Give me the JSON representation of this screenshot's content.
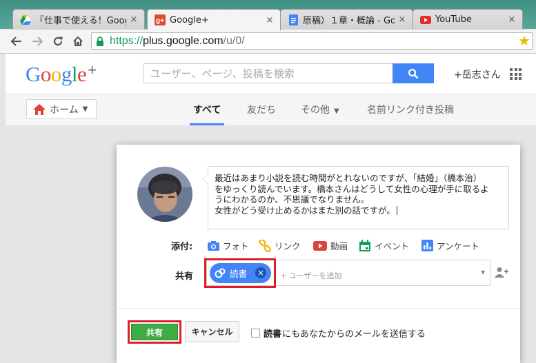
{
  "browser": {
    "tabs": [
      {
        "title": "『仕事で使える！Goog",
        "icon": "google-drive-icon",
        "active": false
      },
      {
        "title": "Google+",
        "icon": "google-plus-icon",
        "active": true
      },
      {
        "title": "原稿）１章・概論 - Goo",
        "icon": "google-docs-icon",
        "active": false
      },
      {
        "title": "YouTube",
        "icon": "youtube-icon",
        "active": false
      }
    ],
    "tab_close_glyph": "×",
    "url": {
      "scheme": "https://",
      "host": "plus.google.com",
      "path": "/u/0/"
    }
  },
  "header": {
    "logo_text": "Google",
    "logo_plus": "+",
    "search_placeholder": "ユーザー、ページ、投稿を検索",
    "user_name": "+岳志さん"
  },
  "nav": {
    "home_label": "ホーム",
    "tabs": [
      {
        "label": "すべて",
        "active": true
      },
      {
        "label": "友だち",
        "active": false
      },
      {
        "label": "その他",
        "active": false,
        "dropdown": true
      },
      {
        "label": "名前リンク付き投稿",
        "active": false
      }
    ]
  },
  "share_box": {
    "post_lines": [
      "最近はあまり小説を読む時間がとれないのですが、「結婚」（橋本治）",
      "をゆっくり読んでいます。橋本さんはどうして女性の心理が手に取るよ",
      "うにわかるのか、不思議でなりません。",
      "女性がどう受け止めるかはまた別の話ですが。"
    ],
    "attach_label": "添付:",
    "attach_items": [
      {
        "label": "フォト",
        "icon": "camera-icon",
        "color": "#4285f4"
      },
      {
        "label": "リンク",
        "icon": "link-icon",
        "color": "#f4b400"
      },
      {
        "label": "動画",
        "icon": "video-icon",
        "color": "#db4437"
      },
      {
        "label": "イベント",
        "icon": "calendar-icon",
        "color": "#0f9d58"
      },
      {
        "label": "アンケート",
        "icon": "poll-icon",
        "color": "#4285f4"
      }
    ],
    "share_label": "共有",
    "chip_label": "読書",
    "chip_remove_glyph": "×",
    "add_user_placeholder": "+ ユーザーを追加",
    "share_button": "共有",
    "cancel_button": "キャンセル",
    "notify_circle": "読書",
    "notify_text": "にもあなたからのメールを送信する"
  },
  "colors": {
    "accent_blue": "#4285f4",
    "share_green": "#3eab45",
    "highlight_red": "#dd1e26"
  }
}
